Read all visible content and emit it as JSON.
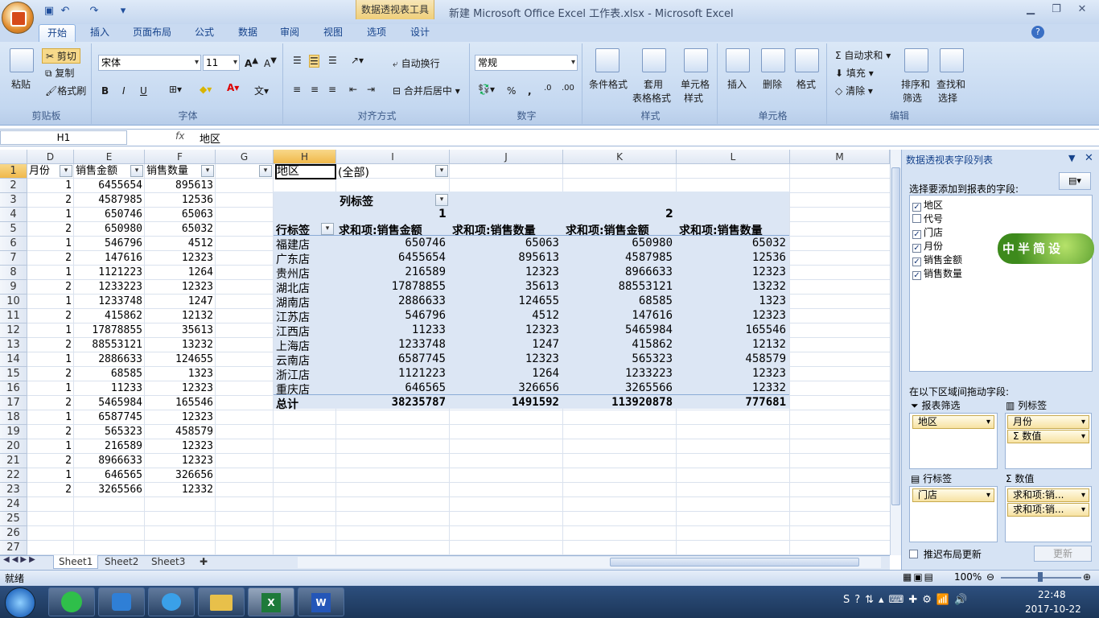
{
  "window": {
    "title": "新建 Microsoft Office Excel 工作表.xlsx - Microsoft Excel",
    "context_tab": "数据透视表工具"
  },
  "tabs": [
    "开始",
    "插入",
    "页面布局",
    "公式",
    "数据",
    "审阅",
    "视图",
    "选项",
    "设计"
  ],
  "ribbon": {
    "clipboard": {
      "label": "剪贴板",
      "paste": "粘贴",
      "cut": "剪切",
      "copy": "复制",
      "format_painter": "格式刷"
    },
    "font": {
      "label": "字体",
      "font_name": "宋体",
      "font_size": "11",
      "bold": "B",
      "italic": "I",
      "underline": "U"
    },
    "alignment": {
      "label": "对齐方式",
      "wrap": "自动换行",
      "merge": "合并后居中"
    },
    "number": {
      "label": "数字",
      "format": "常规",
      "percent": "%",
      "comma": ","
    },
    "styles": {
      "label": "样式",
      "conditional": "条件格式",
      "table1": "套用",
      "table2": "表格格式",
      "cell1": "单元格",
      "cell2": "样式"
    },
    "cells": {
      "label": "单元格",
      "insert": "插入",
      "delete": "删除",
      "format": "格式"
    },
    "editing": {
      "label": "编辑",
      "autosum": "自动求和",
      "fill": "填充",
      "clear": "清除",
      "sort1": "排序和",
      "sort2": "筛选",
      "find1": "查找和",
      "find2": "选择"
    }
  },
  "formula_bar": {
    "name_box": "H1",
    "fx": "fx",
    "content": "地区"
  },
  "columns": [
    {
      "name": "D"
    },
    {
      "name": "E"
    },
    {
      "name": "F"
    },
    {
      "name": "G"
    },
    {
      "name": "H"
    },
    {
      "name": "I"
    },
    {
      "name": "J"
    },
    {
      "name": "K"
    },
    {
      "name": "L"
    },
    {
      "name": "M"
    }
  ],
  "rows": [
    "1",
    "2",
    "3",
    "4",
    "5",
    "6",
    "7",
    "8",
    "9",
    "10",
    "11",
    "12",
    "13",
    "14",
    "15",
    "16",
    "17",
    "18",
    "19",
    "20",
    "21",
    "22",
    "23",
    "24",
    "25",
    "26",
    "27"
  ],
  "table_headers": [
    "月份",
    "销售金额",
    "销售数量"
  ],
  "table_rows": [
    [
      "1",
      "6455654",
      "895613"
    ],
    [
      "2",
      "4587985",
      "12536"
    ],
    [
      "1",
      "650746",
      "65063"
    ],
    [
      "2",
      "650980",
      "65032"
    ],
    [
      "1",
      "546796",
      "4512"
    ],
    [
      "2",
      "147616",
      "12323"
    ],
    [
      "1",
      "1121223",
      "1264"
    ],
    [
      "2",
      "1233223",
      "12323"
    ],
    [
      "1",
      "1233748",
      "1247"
    ],
    [
      "2",
      "415862",
      "12132"
    ],
    [
      "1",
      "17878855",
      "35613"
    ],
    [
      "2",
      "88553121",
      "13232"
    ],
    [
      "1",
      "2886633",
      "124655"
    ],
    [
      "2",
      "68585",
      "1323"
    ],
    [
      "1",
      "11233",
      "12323"
    ],
    [
      "2",
      "5465984",
      "165546"
    ],
    [
      "1",
      "6587745",
      "12323"
    ],
    [
      "2",
      "565323",
      "458579"
    ],
    [
      "1",
      "216589",
      "12323"
    ],
    [
      "2",
      "8966633",
      "12323"
    ],
    [
      "1",
      "646565",
      "326656"
    ],
    [
      "2",
      "3265566",
      "12332"
    ]
  ],
  "pivot": {
    "filter_label": "地区",
    "filter_value": "(全部)",
    "col_label": "列标签",
    "row_label": "行标签",
    "month1": "1",
    "month2": "2",
    "val_headers": [
      "求和项:销售金额",
      "求和项:销售数量",
      "求和项:销售金额",
      "求和项:销售数量"
    ],
    "rows": [
      {
        "store": "福建店",
        "v": [
          "650746",
          "65063",
          "650980",
          "65032"
        ]
      },
      {
        "store": "广东店",
        "v": [
          "6455654",
          "895613",
          "4587985",
          "12536"
        ]
      },
      {
        "store": "贵州店",
        "v": [
          "216589",
          "12323",
          "8966633",
          "12323"
        ]
      },
      {
        "store": "湖北店",
        "v": [
          "17878855",
          "35613",
          "88553121",
          "13232"
        ]
      },
      {
        "store": "湖南店",
        "v": [
          "2886633",
          "124655",
          "68585",
          "1323"
        ]
      },
      {
        "store": "江苏店",
        "v": [
          "546796",
          "4512",
          "147616",
          "12323"
        ]
      },
      {
        "store": "江西店",
        "v": [
          "11233",
          "12323",
          "5465984",
          "165546"
        ]
      },
      {
        "store": "上海店",
        "v": [
          "1233748",
          "1247",
          "415862",
          "12132"
        ]
      },
      {
        "store": "云南店",
        "v": [
          "6587745",
          "12323",
          "565323",
          "458579"
        ]
      },
      {
        "store": "浙江店",
        "v": [
          "1121223",
          "1264",
          "1233223",
          "12323"
        ]
      },
      {
        "store": "重庆店",
        "v": [
          "646565",
          "326656",
          "3265566",
          "12332"
        ]
      }
    ],
    "total_label": "总计",
    "totals": [
      "38235787",
      "1491592",
      "113920878",
      "777681"
    ]
  },
  "sheet_tabs": [
    "Sheet1",
    "Sheet2",
    "Sheet3"
  ],
  "task_pane": {
    "title": "数据透视表字段列表",
    "choose_label": "选择要添加到报表的字段:",
    "fields": [
      {
        "name": "地区",
        "checked": "✓"
      },
      {
        "name": "代号",
        "checked": ""
      },
      {
        "name": "门店",
        "checked": "✓"
      },
      {
        "name": "月份",
        "checked": "✓"
      },
      {
        "name": "销售金额",
        "checked": "✓"
      },
      {
        "name": "销售数量",
        "checked": "✓"
      }
    ],
    "drag_label": "在以下区域间拖动字段:",
    "report_filter": "报表筛选",
    "column_labels": "列标签",
    "row_labels": "行标签",
    "values": "数值",
    "filter_items": [
      "地区"
    ],
    "column_items": [
      "月份",
      "Σ 数值"
    ],
    "row_items": [
      "门店"
    ],
    "value_items": [
      "求和项:销...",
      "求和项:销..."
    ],
    "defer": "推迟布局更新",
    "update": "更新"
  },
  "watermark": "中半简设",
  "status": {
    "ready": "就绪",
    "zoom": "100%"
  },
  "clock": {
    "time": "22:48",
    "date": "2017-10-22"
  },
  "colors": {
    "accent": "#15428b",
    "pivot_bg": "#dce6f4",
    "selected_header": "#f0b84a"
  }
}
